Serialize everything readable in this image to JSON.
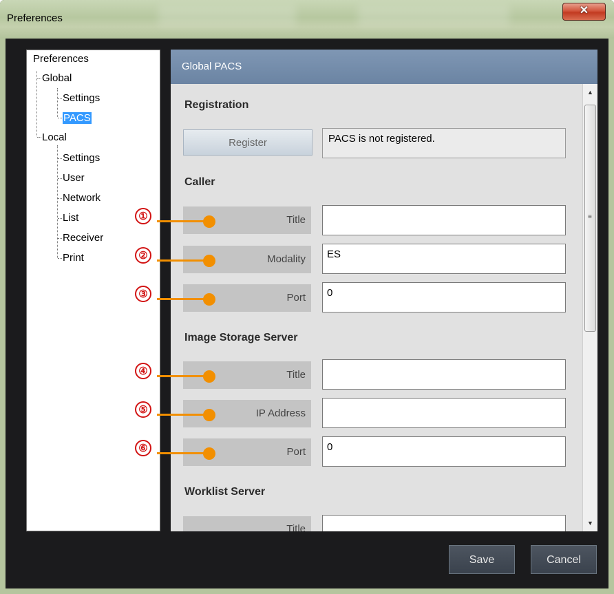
{
  "window": {
    "title": "Preferences",
    "close_glyph": "✕"
  },
  "tree": {
    "root": "Preferences",
    "items": [
      {
        "label": "Global"
      },
      {
        "label": "Settings"
      },
      {
        "label": "PACS",
        "selected": true
      },
      {
        "label": "Local"
      },
      {
        "label": "Settings"
      },
      {
        "label": "User"
      },
      {
        "label": "Network"
      },
      {
        "label": "List"
      },
      {
        "label": "Receiver"
      },
      {
        "label": "Print"
      }
    ]
  },
  "panel": {
    "header": "Global PACS",
    "registration": {
      "title": "Registration",
      "register_button": "Register",
      "status": "PACS is not registered."
    },
    "caller": {
      "title": "Caller",
      "title_label": "Title",
      "title_value": "",
      "modality_label": "Modality",
      "modality_value": "ES",
      "port_label": "Port",
      "port_value": "0"
    },
    "image_storage": {
      "title": "Image Storage Server",
      "title_label": "Title",
      "title_value": "",
      "ip_label": "IP Address",
      "ip_value": "",
      "port_label": "Port",
      "port_value": "0"
    },
    "worklist": {
      "title": "Worklist Server",
      "title_label": "Title"
    }
  },
  "callouts": [
    "①",
    "②",
    "③",
    "④",
    "⑤",
    "⑥"
  ],
  "buttons": {
    "save": "Save",
    "cancel": "Cancel"
  },
  "colors": {
    "callout_line": "#f28f00",
    "callout_number": "#d21414",
    "header": "#7089a8",
    "selection": "#3399ff"
  }
}
